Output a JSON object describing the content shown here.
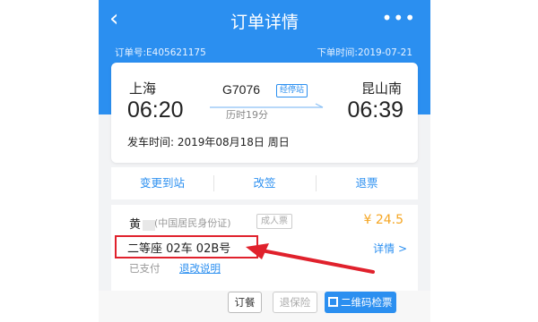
{
  "header": {
    "title": "订单详情",
    "back_icon": "chevron-left-icon",
    "more_icon": "more-icon",
    "order_no": "订单号:E405621175",
    "order_time": "下单时间:2019-07-21",
    "color": "#2b8ff0"
  },
  "trip": {
    "from_station": "上海",
    "from_time": "06:20",
    "to_station": "昆山南",
    "to_time": "06:39",
    "train_no": "G7076",
    "via_label": "经停站",
    "duration": "历时19分",
    "depart_date": "发车时间: 2019年08月18日 周日"
  },
  "actions": {
    "change_station": "变更到站",
    "reschedule": "改签",
    "refund": "退票"
  },
  "passenger": {
    "name": "黄",
    "id_type": "(中国居民身份证)",
    "ticket_type": "成人票",
    "price": "¥ 24.5",
    "seat": "二等座 02车 02B号",
    "detail": "详情 >",
    "status": "已支付",
    "refund_info": "退改说明"
  },
  "buttons": {
    "meal": "订餐",
    "insurance": "退保险",
    "qr_check": "二维码检票"
  },
  "colors": {
    "accent": "#2b8ff0",
    "price": "#f5a623",
    "highlight": "#e0212c"
  }
}
